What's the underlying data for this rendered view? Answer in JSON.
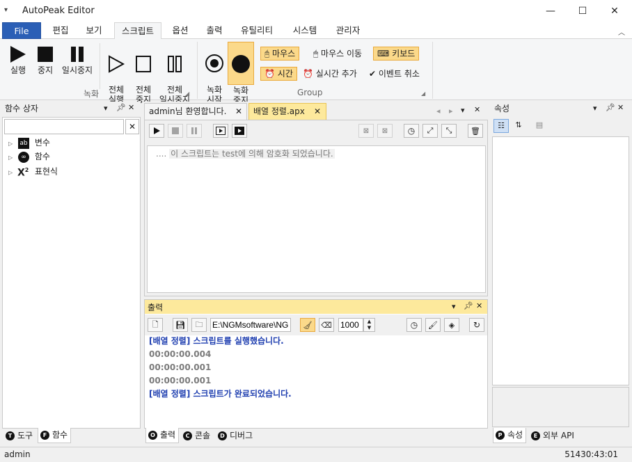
{
  "app": {
    "title": "AutoPeak Editor",
    "quick_access": "▾",
    "window_controls": {
      "minimize": "—",
      "maximize": "☐",
      "close": "✕"
    }
  },
  "ribbon_tabs": [
    "File",
    "편집",
    "보기",
    "스크립트",
    "옵션",
    "출력",
    "유틸리티",
    "시스템",
    "관리자"
  ],
  "ribbon_active_tab": "스크립트",
  "ribbon": {
    "record_group": {
      "label": "녹화",
      "buttons": [
        {
          "label": "실행",
          "icon": "play-icon"
        },
        {
          "label": "중지",
          "icon": "stop-icon"
        },
        {
          "label": "일시중지",
          "icon": "pause-icon"
        },
        {
          "label": "전체\n실행",
          "icon": "play-outline-icon"
        },
        {
          "label": "전체\n중지",
          "icon": "stop-outline-icon"
        },
        {
          "label": "전체\n일시중지",
          "icon": "pause-outline-icon"
        }
      ]
    },
    "group2": {
      "label": "Group",
      "start_record": "녹화\n시작",
      "stop_record": "녹화\n중지",
      "mouse": "마우스",
      "mouse_move": "마우스 이동",
      "keyboard": "키보드",
      "time": "시간",
      "realtime_add": "실시간 추가",
      "cancel_event": "이벤트 취소"
    }
  },
  "function_box": {
    "title": "함수 상자",
    "search_value": "",
    "clear": "✕",
    "items": [
      {
        "label": "변수",
        "icon": "variable-icon"
      },
      {
        "label": "함수",
        "icon": "function-icon"
      },
      {
        "label": "표현식",
        "icon": "expression-icon"
      }
    ],
    "bottom_tabs": [
      {
        "key": "T",
        "label": "도구"
      },
      {
        "key": "F",
        "label": "함수"
      }
    ]
  },
  "editor": {
    "tabs": [
      {
        "label": "admin님 환영합니다.",
        "active": false
      },
      {
        "label": "배열 정렬.apx",
        "active": true
      }
    ],
    "line_text": "이 스크립트는 test에 의해 암호화 되었습니다.",
    "line_prefix": "...."
  },
  "output": {
    "title": "출력",
    "path": "E:\\NGMsoftware\\NG",
    "number": "1000",
    "lines": [
      {
        "text": "[배열 정렬] 스크립트를 실행했습니다.",
        "color": "#1f3fb0"
      },
      {
        "text": "00:00:00.004",
        "color": "#7b7b7b"
      },
      {
        "text": "00:00:00.001",
        "color": "#7b7b7b"
      },
      {
        "text": "00:00:00.001",
        "color": "#7b7b7b"
      },
      {
        "text": "[배열 정렬] 스크립트가 완료되었습니다.",
        "color": "#1f3fb0"
      }
    ],
    "bottom_tabs": [
      {
        "key": "O",
        "label": "출력"
      },
      {
        "key": "C",
        "label": "콘솔"
      },
      {
        "key": "D",
        "label": "디버그"
      }
    ]
  },
  "properties": {
    "title": "속성",
    "bottom_tabs": [
      {
        "key": "P",
        "label": "속성"
      },
      {
        "key": "E",
        "label": "외부 API"
      }
    ]
  },
  "status": {
    "user": "admin",
    "clock": "51430:43:01"
  },
  "colors": {
    "accent": "#2b5fb6",
    "highlight": "#fbd98a",
    "highlight_border": "#e9a93c",
    "output_header": "#fde99c"
  }
}
